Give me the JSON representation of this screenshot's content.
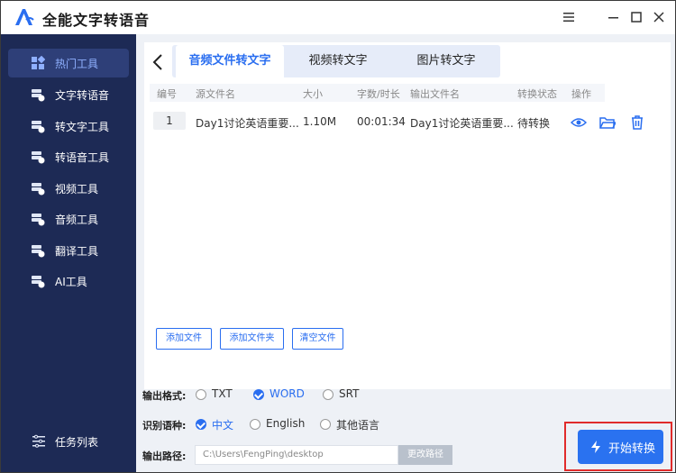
{
  "app": {
    "title": "全能文字转语音"
  },
  "sidebar": {
    "items": [
      {
        "label": "热门工具",
        "icon": "hot-tools-icon"
      },
      {
        "label": "文字转语音",
        "icon": "text-to-speech-icon"
      },
      {
        "label": "转文字工具",
        "icon": "to-text-tools-icon"
      },
      {
        "label": "转语音工具",
        "icon": "to-speech-tools-icon"
      },
      {
        "label": "视频工具",
        "icon": "video-tools-icon"
      },
      {
        "label": "音频工具",
        "icon": "audio-tools-icon"
      },
      {
        "label": "翻译工具",
        "icon": "translate-tools-icon"
      },
      {
        "label": "AI工具",
        "icon": "ai-tools-icon"
      }
    ],
    "task_list": "任务列表"
  },
  "tabs": [
    "音频文件转文字",
    "视频转文字",
    "图片转文字"
  ],
  "table": {
    "headers": [
      "编号",
      "源文件名",
      "大小",
      "字数/时长",
      "输出文件名",
      "转换状态",
      "操作"
    ],
    "rows": [
      {
        "num": "1",
        "source": "Day1讨论英语重要...",
        "size": "1.10M",
        "duration": "00:01:34",
        "output": "Day1讨论英语重要...",
        "status": "待转换"
      }
    ]
  },
  "buttons": {
    "add_file": "添加文件",
    "add_folder": "添加文件夹",
    "clear_files": "清空文件",
    "change_path": "更改路径",
    "start": "开始转换"
  },
  "settings": {
    "format_label": "输出格式:",
    "formats": [
      "TXT",
      "WORD",
      "SRT"
    ],
    "selected_format": "WORD",
    "language_label": "识别语种:",
    "languages": [
      "中文",
      "English",
      "其他语言"
    ],
    "selected_language": "中文",
    "path_label": "输出路径:",
    "path_value": "C:\\Users\\FengPing\\desktop"
  },
  "colors": {
    "accent": "#2a6ef0",
    "sidebar_bg": "#1d2a55",
    "highlight_border": "#e02b2b"
  }
}
